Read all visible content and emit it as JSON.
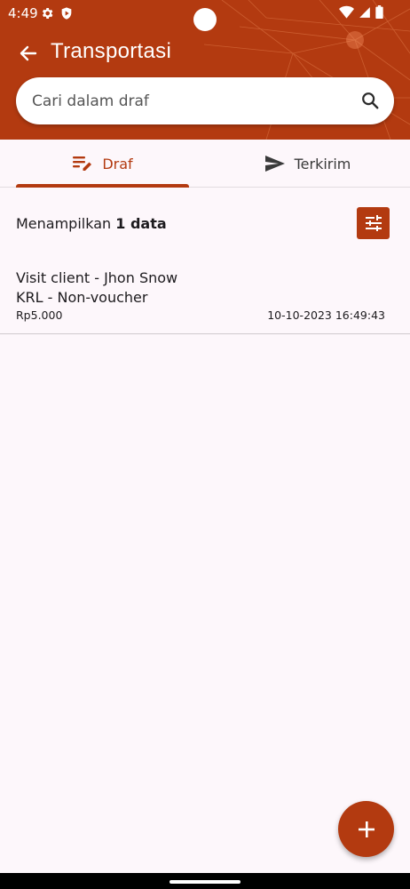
{
  "status_bar": {
    "time": "4:49"
  },
  "appbar": {
    "title": "Transportasi",
    "back_icon": "arrow-left-icon"
  },
  "search": {
    "placeholder": "Cari dalam draf",
    "icon": "search-icon"
  },
  "tabs": [
    {
      "label": "Draf",
      "icon": "edit-note-icon",
      "active": true
    },
    {
      "label": "Terkirim",
      "icon": "send-icon",
      "active": false
    }
  ],
  "summary": {
    "prefix": "Menampilkan",
    "count": "1 data"
  },
  "items": [
    {
      "title": "Visit client - Jhon Snow",
      "subtitle": "KRL - Non-voucher",
      "amount": "Rp5.000",
      "date": "10-10-2023 16:49:43"
    }
  ],
  "colors": {
    "primary": "#b33a10",
    "background": "#fdf7fb"
  }
}
